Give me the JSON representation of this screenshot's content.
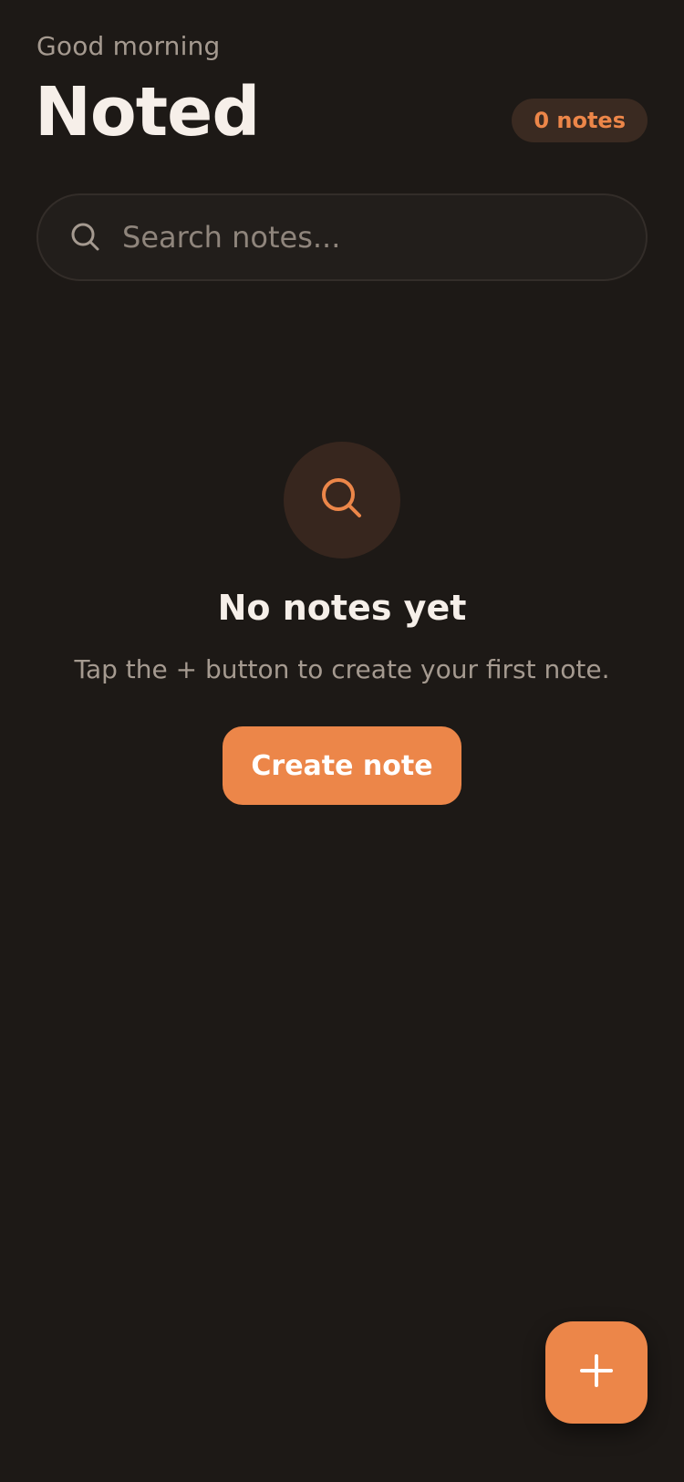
{
  "header": {
    "greeting": "Good morning",
    "title": "Noted",
    "note_count": "0 notes"
  },
  "search": {
    "placeholder": "Search notes...",
    "value": "",
    "icon": "search-icon"
  },
  "empty_state": {
    "icon": "search-icon",
    "title": "No notes yet",
    "message": "Tap the + button to create your first note.",
    "button_label": "Create note"
  },
  "fab": {
    "icon": "plus-icon"
  },
  "colors": {
    "background": "#1d1916",
    "accent": "#ec8649",
    "text_primary": "#f6efe9",
    "text_secondary": "#a59a90",
    "badge_background": "#3a2a21"
  }
}
